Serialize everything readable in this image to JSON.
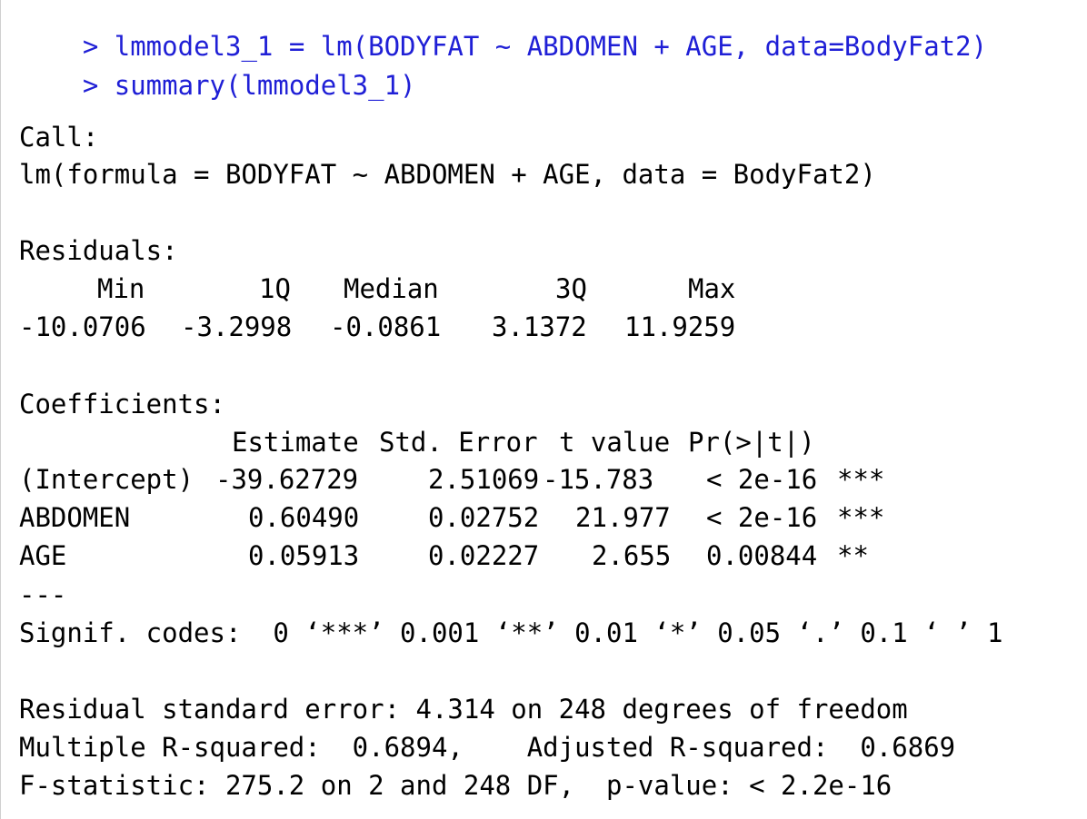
{
  "console": {
    "commands": [
      {
        "prompt": "> ",
        "text": "lmmodel3_1 = lm(BODYFAT ~ ABDOMEN + AGE, data=BodyFat2)"
      },
      {
        "prompt": "> ",
        "text": "summary(lmmodel3_1)"
      }
    ],
    "call_header": "Call:",
    "call_formula": "lm(formula = BODYFAT ~ ABDOMEN + AGE, data = BodyFat2)",
    "residuals_header": "Residuals:",
    "residuals": {
      "labels": [
        "Min",
        "1Q",
        "Median",
        "3Q",
        "Max"
      ],
      "values": [
        "-10.0706",
        "-3.2998",
        "-0.0861",
        "3.1372",
        "11.9259"
      ]
    },
    "coefficients_header": "Coefficients:",
    "coefficients": {
      "columns": [
        "Estimate",
        "Std. Error",
        "t value",
        "Pr(>|t|)"
      ],
      "rows": [
        {
          "name": "(Intercept)",
          "estimate": "-39.62729",
          "std_error": "2.51069",
          "t_value": "-15.783",
          "p": "< 2e-16",
          "signif": "***"
        },
        {
          "name": "ABDOMEN",
          "estimate": "0.60490",
          "std_error": "0.02752",
          "t_value": "21.977",
          "p": "< 2e-16",
          "signif": "***"
        },
        {
          "name": "AGE",
          "estimate": "0.05913",
          "std_error": "0.02227",
          "t_value": "2.655",
          "p": "0.00844",
          "signif": "**"
        }
      ]
    },
    "separator": "---",
    "signif_codes": "Signif. codes:  0 ‘***’ 0.001 ‘**’ 0.01 ‘*’ 0.05 ‘.’ 0.1 ‘ ’ 1",
    "summary_lines": [
      "Residual standard error: 4.314 on 248 degrees of freedom",
      "Multiple R-squared:  0.6894,\tAdjusted R-squared:  0.6869",
      "F-statistic: 275.2 on 2 and 248 DF,  p-value: < 2.2e-16"
    ],
    "colors": {
      "input": "#1f1fd6",
      "output": "#000000",
      "background": "#ffffff"
    }
  }
}
